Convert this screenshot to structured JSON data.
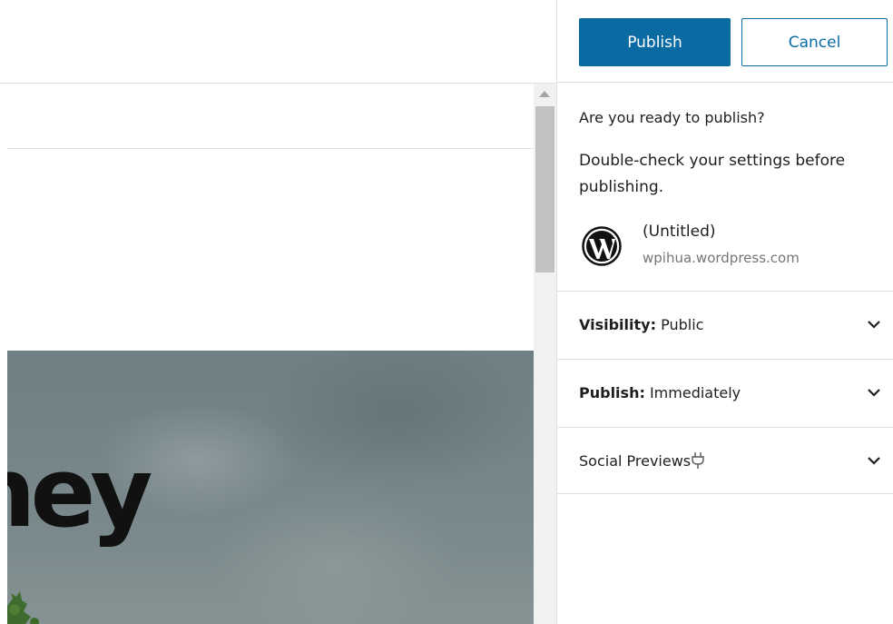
{
  "editor": {
    "cover_title": "ney"
  },
  "panel": {
    "publish_button": "Publish",
    "cancel_button": "Cancel",
    "ready_heading": "Are you ready to publish?",
    "description": "Double-check your settings before publishing.",
    "site": {
      "title": "(Untitled)",
      "url": "wpihua.wordpress.com",
      "logo_icon": "wordpress-logo-icon"
    },
    "rows": {
      "visibility": {
        "label": "Visibility:",
        "value": "Public"
      },
      "publish": {
        "label": "Publish:",
        "value": "Immediately"
      },
      "social": {
        "label": "Social Previews",
        "icon": "plug-icon"
      }
    }
  },
  "colors": {
    "accent": "#0a6ba3",
    "border": "#e0e0e0",
    "muted_text": "#757575"
  }
}
